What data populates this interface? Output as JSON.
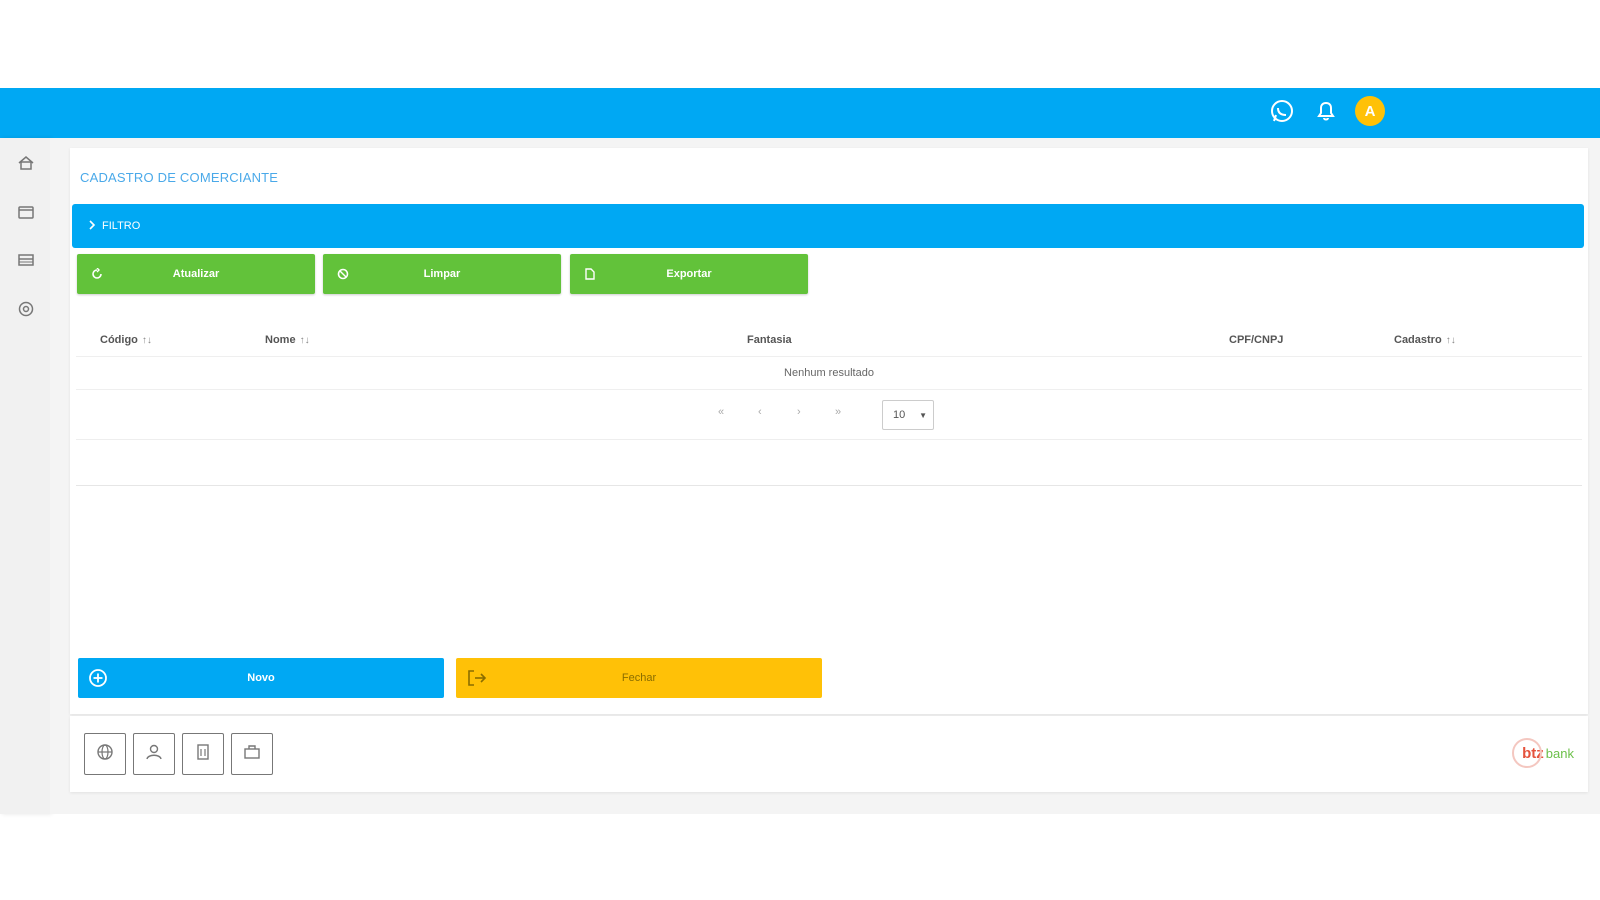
{
  "header": {
    "avatar_initial": "A",
    "icons": [
      "whatsapp-icon",
      "bell-icon"
    ]
  },
  "sidebar": {
    "items": [
      {
        "icon": "home-icon"
      },
      {
        "icon": "wallet-icon"
      },
      {
        "icon": "card-icon"
      },
      {
        "icon": "support-icon"
      }
    ]
  },
  "page": {
    "title": "CADASTRO DE COMERCIANTE"
  },
  "filter": {
    "label": "FILTRO"
  },
  "actions": {
    "refresh_label": "Atualizar",
    "clear_label": "Limpar",
    "export_label": "Exportar"
  },
  "table": {
    "columns": [
      {
        "label": "Código",
        "sortable": true
      },
      {
        "label": "Nome",
        "sortable": true
      },
      {
        "label": "Fantasia",
        "sortable": false
      },
      {
        "label": "CPF/CNPJ",
        "sortable": false
      },
      {
        "label": "Cadastro",
        "sortable": true
      }
    ],
    "empty_message": "Nenhum resultado",
    "sort_glyph": "↑↓"
  },
  "pagination": {
    "first": "«",
    "prev": "‹",
    "next": "›",
    "last": "»",
    "page_size": "10"
  },
  "bottom_actions": {
    "new_label": "Novo",
    "close_label": "Fechar"
  },
  "footer": {
    "buttons": [
      "globe-icon",
      "user-icon",
      "document-icon",
      "briefcase-icon"
    ],
    "logo_text": "btz",
    "logo_suffix": "bank"
  },
  "colors": {
    "primary": "#00a8f3",
    "success": "#62c23a",
    "warning": "#ffc107"
  }
}
